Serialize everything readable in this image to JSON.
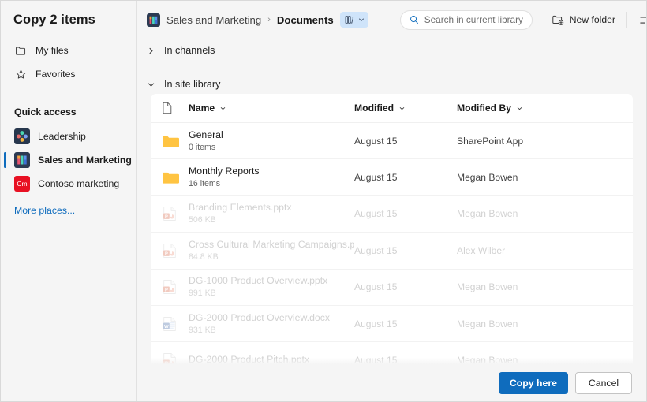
{
  "dialog": {
    "title": "Copy 2 items"
  },
  "sidebar": {
    "nav": [
      {
        "label": "My files",
        "icon": "folder-outline-icon"
      },
      {
        "label": "Favorites",
        "icon": "star-outline-icon"
      }
    ],
    "quick_access_label": "Quick access",
    "quick_access": [
      {
        "label": "Leadership",
        "icon": "leadership-site-icon",
        "selected": false
      },
      {
        "label": "Sales and Marketing",
        "icon": "sales-marketing-site-icon",
        "selected": true
      },
      {
        "label": "Contoso marketing",
        "icon": "contoso-marketing-site-icon",
        "initials": "Cm",
        "selected": false
      }
    ],
    "more_places": "More places..."
  },
  "topbar": {
    "breadcrumb": [
      {
        "label": "Sales and Marketing",
        "current": false
      },
      {
        "label": "Documents",
        "current": true
      }
    ],
    "separator": "›",
    "library_picker": {
      "icon": "library-books-icon",
      "chevron": "chevron-down-icon"
    },
    "search": {
      "placeholder": "Search in current library",
      "icon": "search-icon"
    },
    "new_folder": {
      "label": "New folder",
      "icon": "new-folder-icon"
    },
    "view_options": {
      "icon": "list-view-icon",
      "chevron": "chevron-down-icon"
    }
  },
  "sections": [
    {
      "id": "in-channels",
      "label": "In channels",
      "expanded": false,
      "chevron": "chevron-right-icon"
    },
    {
      "id": "in-site-library",
      "label": "In site library",
      "expanded": true,
      "chevron": "chevron-down-icon"
    }
  ],
  "grid": {
    "columns": {
      "icon": "file-type-icon",
      "name": "Name",
      "modified": "Modified",
      "modified_by": "Modified By",
      "sort_chevron": "chevron-down-icon"
    },
    "rows": [
      {
        "name": "General",
        "sub": "0 items",
        "modified": "August 15",
        "modified_by": "SharePoint App",
        "icon": "folder-icon",
        "disabled": false
      },
      {
        "name": "Monthly Reports",
        "sub": "16 items",
        "modified": "August 15",
        "modified_by": "Megan Bowen",
        "icon": "folder-icon",
        "disabled": false
      },
      {
        "name": "Branding Elements.pptx",
        "sub": "506 KB",
        "modified": "August 15",
        "modified_by": "Megan Bowen",
        "icon": "powerpoint-icon",
        "disabled": true
      },
      {
        "name": "Cross Cultural Marketing Campaigns.p…",
        "sub": "84.8 KB",
        "modified": "August 15",
        "modified_by": "Alex Wilber",
        "icon": "powerpoint-icon",
        "disabled": true
      },
      {
        "name": "DG-1000 Product Overview.pptx",
        "sub": "991 KB",
        "modified": "August 15",
        "modified_by": "Megan Bowen",
        "icon": "powerpoint-icon",
        "disabled": true
      },
      {
        "name": "DG-2000 Product Overview.docx",
        "sub": "931 KB",
        "modified": "August 15",
        "modified_by": "Megan Bowen",
        "icon": "word-icon",
        "disabled": true
      },
      {
        "name": "DG-2000 Product Pitch.pptx",
        "sub": "",
        "modified": "August 15",
        "modified_by": "Megan Bowen",
        "icon": "powerpoint-icon",
        "disabled": true
      }
    ]
  },
  "footer": {
    "primary": "Copy here",
    "secondary": "Cancel"
  },
  "colors": {
    "accent": "#0f6cbd",
    "folder": "#ffc442",
    "powerpoint": "#d35230",
    "word": "#2b579a",
    "link": "#0f6cbd"
  }
}
